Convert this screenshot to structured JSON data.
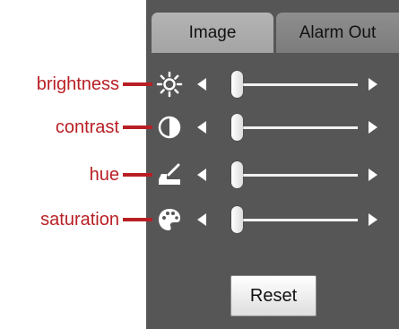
{
  "tabs": [
    {
      "label": "Image",
      "active": true
    },
    {
      "label": "Alarm Out",
      "active": false
    }
  ],
  "controls": [
    {
      "label": "brightness",
      "icon": "brightness-icon"
    },
    {
      "label": "contrast",
      "icon": "contrast-icon"
    },
    {
      "label": "hue",
      "icon": "hue-icon"
    },
    {
      "label": "saturation",
      "icon": "saturation-icon"
    }
  ],
  "reset_label": "Reset",
  "colors": {
    "annotation": "#b81f24",
    "panel": "#565656",
    "tab_active": "#aaaaaa",
    "tab_inactive": "#838383"
  }
}
